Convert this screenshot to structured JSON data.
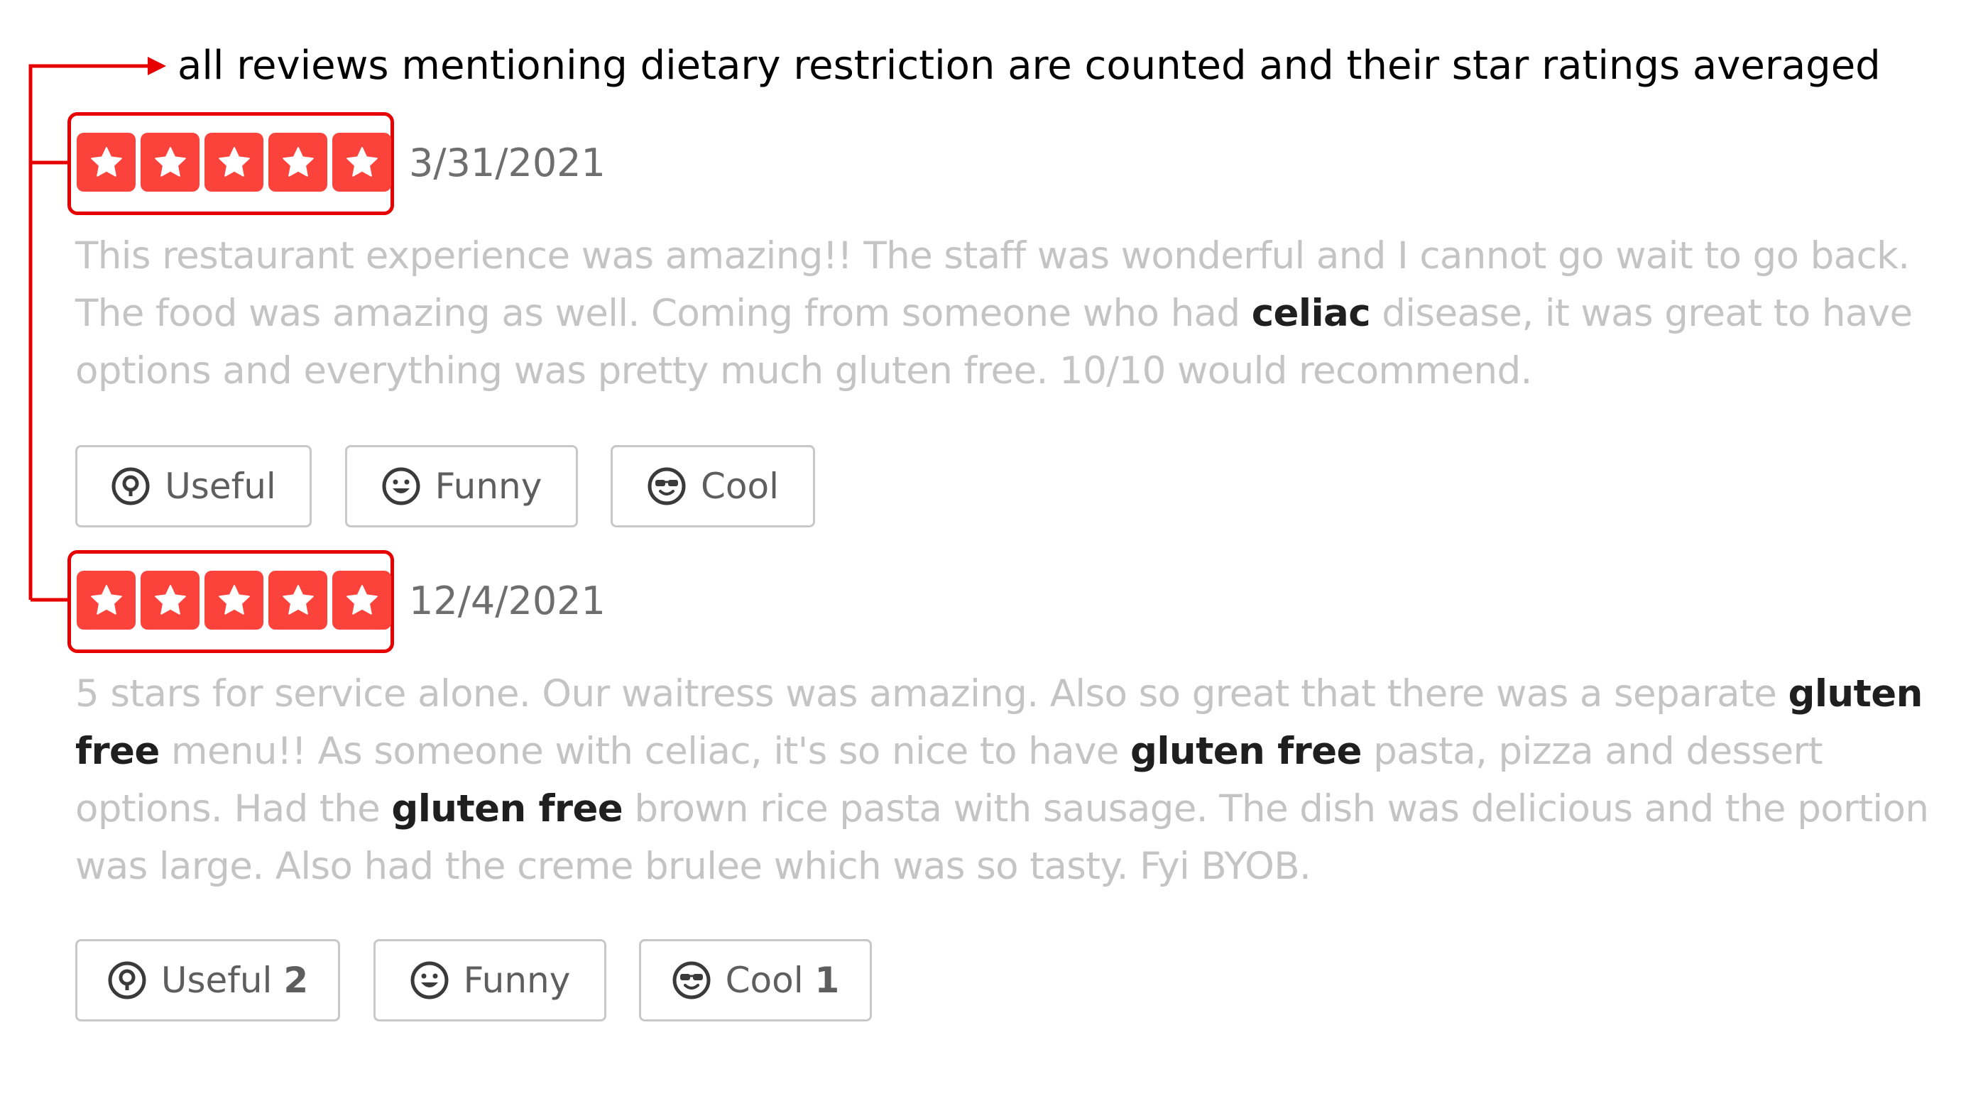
{
  "annotation": {
    "text": "all reviews mentioning dietary restriction are counted and their star ratings averaged",
    "color": "#e60000"
  },
  "reviews": [
    {
      "rating": 5,
      "date": "3/31/2021",
      "lines": [
        [
          {
            "t": "This restaurant experience was amazing!! The staff was wonderful and I cannot go wait to go back."
          }
        ],
        [
          {
            "t": "The food was amazing as well. Coming from someone who had "
          },
          {
            "t": "celiac",
            "b": true
          },
          {
            "t": " disease, it was great to have"
          }
        ],
        [
          {
            "t": "options and everything was pretty much gluten free. 10/10 would recommend."
          }
        ]
      ],
      "reactions": {
        "useful": {
          "label": "Useful",
          "count": ""
        },
        "funny": {
          "label": "Funny",
          "count": ""
        },
        "cool": {
          "label": "Cool",
          "count": ""
        }
      }
    },
    {
      "rating": 5,
      "date": "12/4/2021",
      "lines": [
        [
          {
            "t": "5 stars for service alone.  Our waitress was amazing.  Also so great that there was a separate "
          },
          {
            "t": "gluten",
            "b": true
          }
        ],
        [
          {
            "t": "free",
            "b": true
          },
          {
            "t": " menu!!  As someone with celiac, it's so nice to have "
          },
          {
            "t": "gluten free",
            "b": true
          },
          {
            "t": " pasta, pizza and dessert"
          }
        ],
        [
          {
            "t": "options.  Had the "
          },
          {
            "t": "gluten free",
            "b": true
          },
          {
            "t": " brown rice pasta with sausage. The dish was delicious and the portion"
          }
        ],
        [
          {
            "t": "was large.  Also had the creme brulee which was so tasty.  Fyi BYOB."
          }
        ]
      ],
      "reactions": {
        "useful": {
          "label": "Useful",
          "count": "2"
        },
        "funny": {
          "label": "Funny",
          "count": ""
        },
        "cool": {
          "label": "Cool",
          "count": "1"
        }
      }
    }
  ],
  "colors": {
    "star_tile": "#fb433c",
    "highlight": "#e60000",
    "keyword": "#1f1f1f",
    "body_text": "#c4c4c4"
  }
}
